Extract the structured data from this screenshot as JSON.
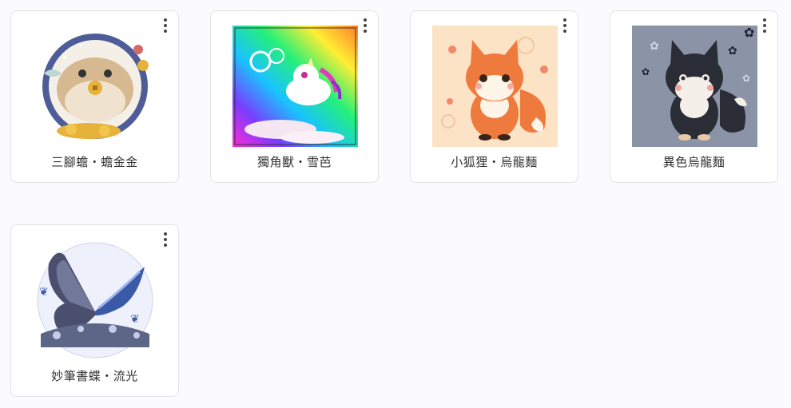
{
  "cards": [
    {
      "label": "三腳蟾・蟾金金",
      "image": "golden-toad-sticker",
      "menu_icon": "more-vertical-icon"
    },
    {
      "label": "獨角獸・雪芭",
      "image": "rainbow-unicorn-sticker",
      "menu_icon": "more-vertical-icon"
    },
    {
      "label": "小狐狸・烏龍麵",
      "image": "orange-fox-sticker",
      "menu_icon": "more-vertical-icon"
    },
    {
      "label": "異色烏龍麵",
      "image": "black-fox-sticker",
      "menu_icon": "more-vertical-icon"
    },
    {
      "label": "妙筆書蝶・流光",
      "image": "blue-butterfly-sticker",
      "menu_icon": "more-vertical-icon"
    }
  ],
  "colors": {
    "background": "#fbfbfd",
    "card_border": "#e3e3e8",
    "label_text": "#333333"
  }
}
